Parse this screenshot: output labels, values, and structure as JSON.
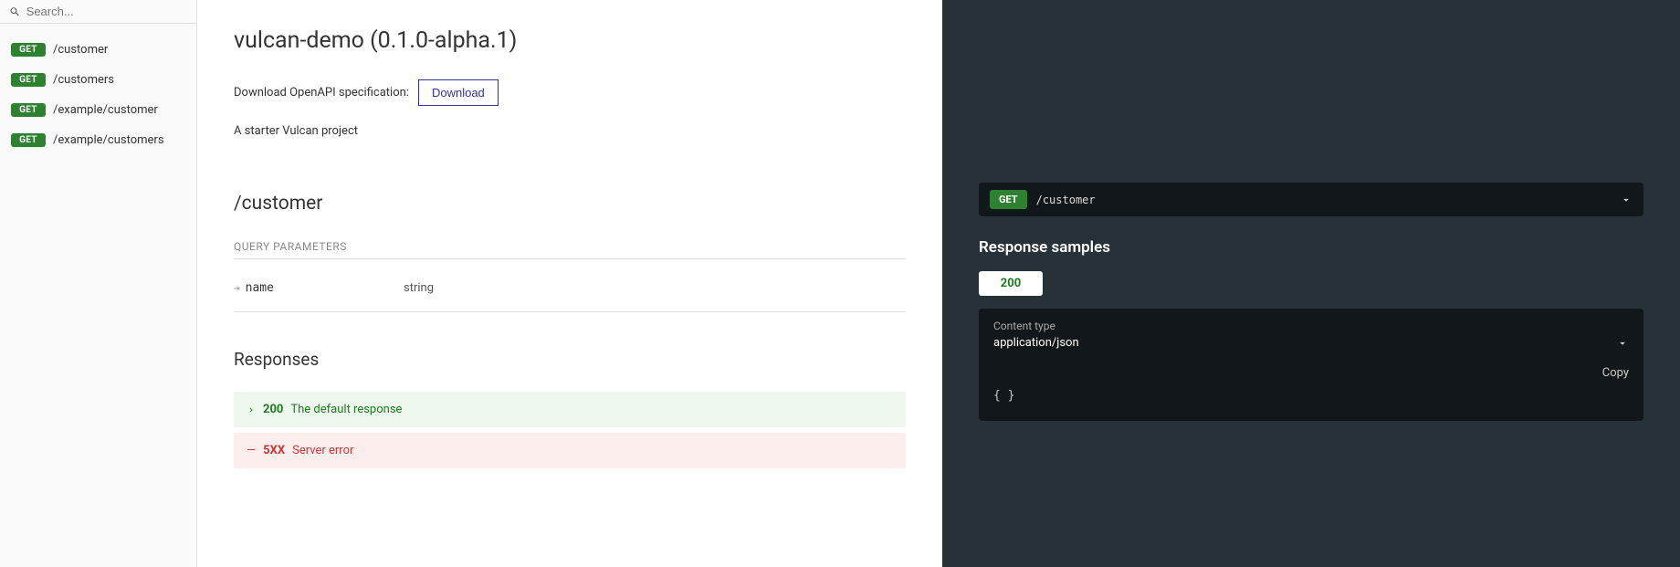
{
  "search": {
    "placeholder": "Search..."
  },
  "sidebar": {
    "items": [
      {
        "method": "GET",
        "path": "/customer"
      },
      {
        "method": "GET",
        "path": "/customers"
      },
      {
        "method": "GET",
        "path": "/example/customer"
      },
      {
        "method": "GET",
        "path": "/example/customers"
      }
    ]
  },
  "header": {
    "title": "vulcan-demo (0.1.0-alpha.1)",
    "download_label": "Download OpenAPI specification:",
    "download_button": "Download",
    "description": "A starter Vulcan project"
  },
  "operation": {
    "title": "/customer",
    "query_params_label": "QUERY PARAMETERS",
    "params": [
      {
        "name": "name",
        "type": "string"
      }
    ],
    "responses_label": "Responses",
    "responses": [
      {
        "code": "200",
        "desc": "The default response",
        "kind": "success"
      },
      {
        "code": "5XX",
        "desc": "Server error",
        "kind": "error"
      }
    ]
  },
  "tryit": {
    "method": "GET",
    "path": "/customer"
  },
  "samples": {
    "title": "Response samples",
    "tabs": [
      {
        "label": "200"
      }
    ],
    "content_type_label": "Content type",
    "content_type_value": "application/json",
    "copy_label": "Copy",
    "body": "{ }"
  }
}
